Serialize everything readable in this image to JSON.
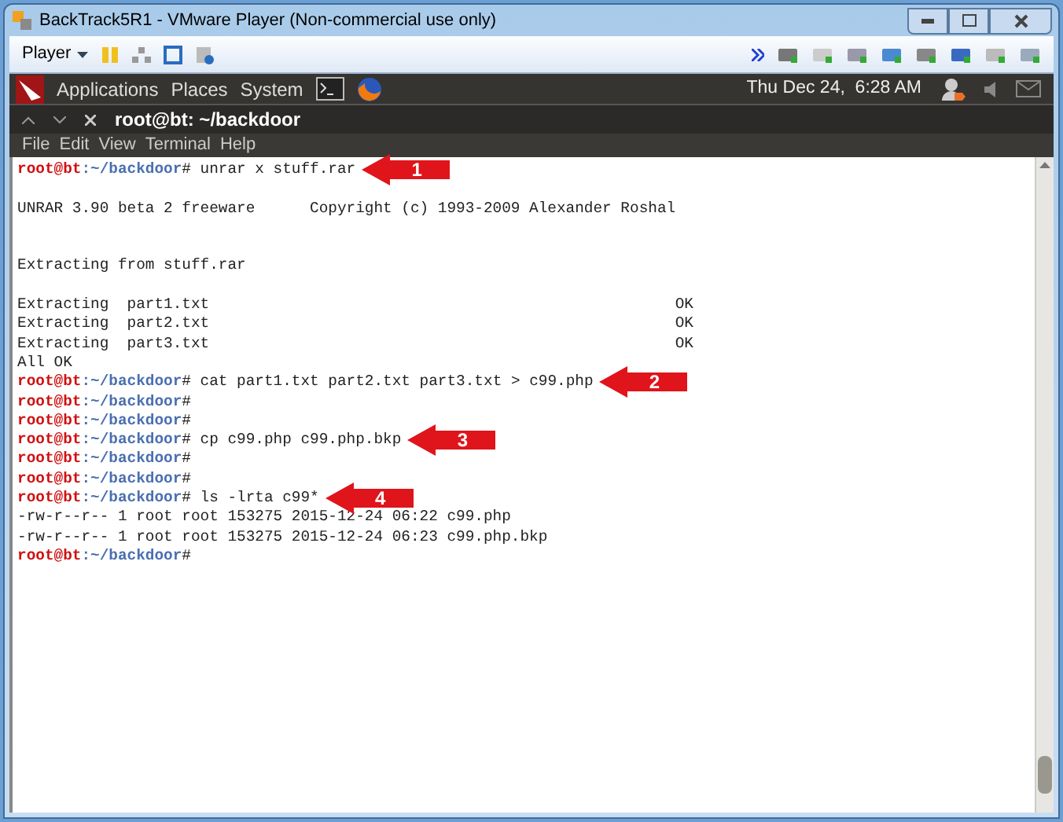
{
  "window": {
    "title": "BackTrack5R1 - VMware Player (Non-commercial use only)"
  },
  "player_toolbar": {
    "menu": "Player"
  },
  "panel": {
    "menus": [
      "Applications",
      "Places",
      "System"
    ],
    "clock": "Thu Dec 24,  6:28 AM"
  },
  "terminal": {
    "title": "root@bt: ~/backdoor",
    "menus": [
      "File",
      "Edit",
      "View",
      "Terminal",
      "Help"
    ],
    "lines": [
      {
        "kind": "prompt",
        "user": "root@bt",
        "path": ":~/backdoor",
        "command": "# unrar x stuff.rar",
        "callout": "1"
      },
      {
        "kind": "blank"
      },
      {
        "kind": "output",
        "text": "UNRAR 3.90 beta 2 freeware      Copyright (c) 1993-2009 Alexander Roshal"
      },
      {
        "kind": "blank"
      },
      {
        "kind": "blank"
      },
      {
        "kind": "output",
        "text": "Extracting from stuff.rar"
      },
      {
        "kind": "blank"
      },
      {
        "kind": "status",
        "text": "Extracting  part1.txt",
        "status": "OK"
      },
      {
        "kind": "status",
        "text": "Extracting  part2.txt",
        "status": "OK"
      },
      {
        "kind": "status",
        "text": "Extracting  part3.txt",
        "status": "OK"
      },
      {
        "kind": "output",
        "text": "All OK"
      },
      {
        "kind": "prompt",
        "user": "root@bt",
        "path": ":~/backdoor",
        "command": "# cat part1.txt part2.txt part3.txt > c99.php",
        "callout": "2"
      },
      {
        "kind": "prompt",
        "user": "root@bt",
        "path": ":~/backdoor",
        "command": "#"
      },
      {
        "kind": "prompt",
        "user": "root@bt",
        "path": ":~/backdoor",
        "command": "#"
      },
      {
        "kind": "prompt",
        "user": "root@bt",
        "path": ":~/backdoor",
        "command": "# cp c99.php c99.php.bkp",
        "callout": "3"
      },
      {
        "kind": "prompt",
        "user": "root@bt",
        "path": ":~/backdoor",
        "command": "#"
      },
      {
        "kind": "prompt",
        "user": "root@bt",
        "path": ":~/backdoor",
        "command": "#"
      },
      {
        "kind": "prompt",
        "user": "root@bt",
        "path": ":~/backdoor",
        "command": "# ls -lrta c99*",
        "callout": "4"
      },
      {
        "kind": "output",
        "text": "-rw-r--r-- 1 root root 153275 2015-12-24 06:22 c99.php"
      },
      {
        "kind": "output",
        "text": "-rw-r--r-- 1 root root 153275 2015-12-24 06:23 c99.php.bkp"
      },
      {
        "kind": "prompt",
        "user": "root@bt",
        "path": ":~/backdoor",
        "command": "#"
      }
    ]
  }
}
